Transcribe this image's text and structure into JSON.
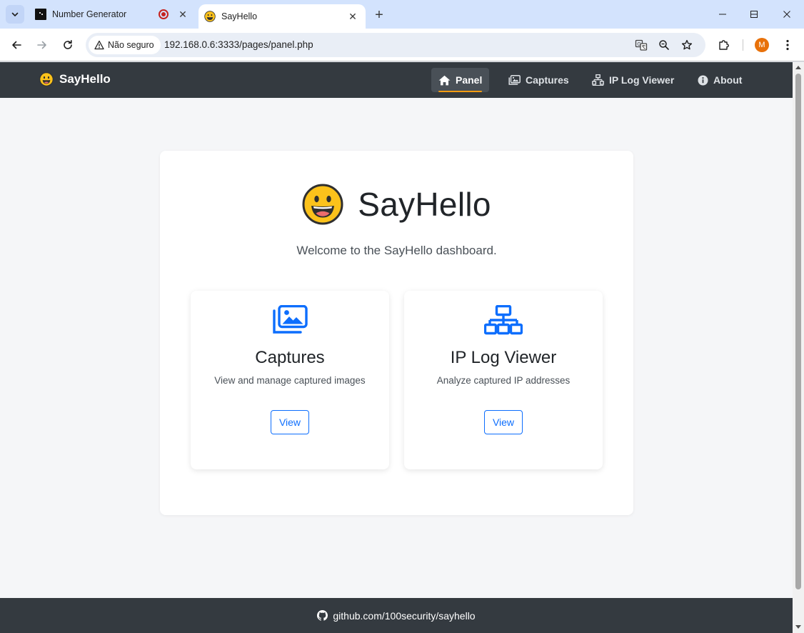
{
  "browser": {
    "tabs": [
      {
        "title": "Number Generator",
        "favicon": "terminal-icon",
        "recording": true,
        "active": false
      },
      {
        "title": "SayHello",
        "favicon": "grinning-face-icon",
        "active": true
      }
    ],
    "security_label": "Não seguro",
    "url": "192.168.0.6:3333/pages/panel.php",
    "profile_initial": "M",
    "colors": {
      "tabstrip": "#d3e3fd",
      "omnibox": "#e9eef6",
      "avatar": "#e8710a"
    }
  },
  "navbar": {
    "brand": "SayHello",
    "links": [
      {
        "label": "Panel",
        "icon": "home-icon",
        "active": true
      },
      {
        "label": "Captures",
        "icon": "images-icon",
        "active": false
      },
      {
        "label": "IP Log Viewer",
        "icon": "network-icon",
        "active": false
      },
      {
        "label": "About",
        "icon": "info-icon",
        "active": false
      }
    ],
    "colors": {
      "background": "#343a40",
      "active_underline": "#f39c12"
    }
  },
  "hero": {
    "title": "SayHello",
    "subtitle": "Welcome to the SayHello dashboard."
  },
  "cards": [
    {
      "title": "Captures",
      "text": "View and manage captured images",
      "button": "View",
      "icon": "images-icon"
    },
    {
      "title": "IP Log Viewer",
      "text": "Analyze captured IP addresses",
      "button": "View",
      "icon": "network-icon"
    }
  ],
  "footer": {
    "link": "github.com/100security/sayhello",
    "icon": "github-icon"
  },
  "colors": {
    "accent": "#0d6efd",
    "page_background": "#f5f6f8"
  }
}
